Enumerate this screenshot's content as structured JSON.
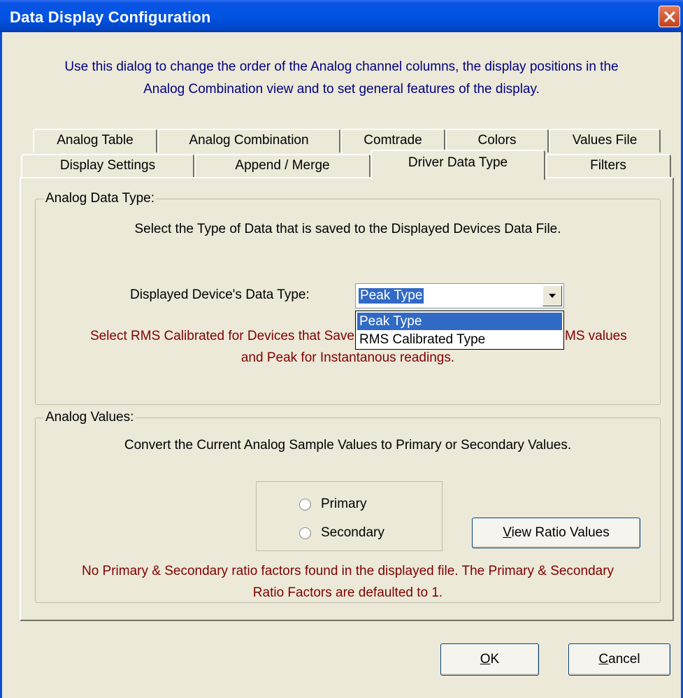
{
  "window": {
    "title": "Data Display Configuration",
    "intro_line1": "Use this dialog to change the order of the Analog channel columns, the display positions in the",
    "intro_line2": "Analog Combination view and to set general features of the display."
  },
  "tabs_row1": [
    "Analog Table",
    "Analog Combination",
    "Comtrade",
    "Colors",
    "Values File"
  ],
  "tabs_row2": [
    "Display Settings",
    "Append / Merge",
    "Driver Data Type",
    "Filters"
  ],
  "active_tab": "Driver Data Type",
  "analog_data_type": {
    "legend": "Analog Data Type:",
    "description": "Select the Type of Data that is saved to the Displayed Devices Data File.",
    "field_label": "Displayed Device's Data Type:",
    "selected_value": "Peak Type",
    "options": [
      "Peak Type",
      "RMS Calibrated Type"
    ],
    "note_line1_left": "Select RMS Calibrated for Devices that Save",
    "note_line1_right": "MS values",
    "note_line2": "and Peak for Instantanous readings."
  },
  "analog_values": {
    "legend": "Analog Values:",
    "description": "Convert the Current Analog Sample Values to Primary or Secondary Values.",
    "radio_primary": "Primary",
    "radio_secondary": "Secondary",
    "view_ratio_button_mnemonic": "V",
    "view_ratio_button_rest": "iew Ratio Values",
    "note_line1": "No Primary & Secondary ratio factors found in the displayed file. The Primary & Secondary",
    "note_line2": "Ratio Factors are defaulted to 1."
  },
  "buttons": {
    "ok_mnemonic": "O",
    "ok_rest": "K",
    "cancel_mnemonic": "C",
    "cancel_rest": "ancel"
  },
  "colors": {
    "titlebar": "#0054e3",
    "dialog_bg": "#ece9d8",
    "intro_text": "#000080",
    "note_text": "#800000",
    "selection": "#316ac5"
  }
}
